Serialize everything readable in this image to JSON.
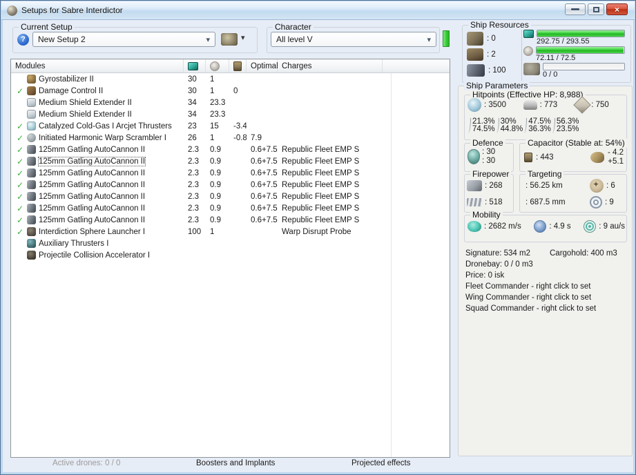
{
  "window": {
    "title": "Setups for Sabre Interdictor",
    "controls": {
      "minimize": "minimize",
      "maximize": "maximize",
      "close": "close"
    }
  },
  "toolbar": {
    "current_setup_label": "Current Setup",
    "setup_value": "New Setup 2",
    "character_label": "Character",
    "character_value": "All level V"
  },
  "modules_table": {
    "headers": {
      "modules": "Modules",
      "cpu_icon": "cpu-icon",
      "powergrid_icon": "powergrid-icon",
      "capacitor_icon": "capacitor-icon",
      "optimal": "Optimal",
      "charges": "Charges"
    },
    "rows": [
      {
        "checked": false,
        "icon": "gyrostabilizer",
        "name": "Gyrostabilizer II",
        "cpu": "30",
        "pg": "1",
        "cap": "",
        "optimal": "",
        "charges": "",
        "focused": false
      },
      {
        "checked": true,
        "icon": "damage-control",
        "name": "Damage Control II",
        "cpu": "30",
        "pg": "1",
        "cap": "0",
        "optimal": "",
        "charges": "",
        "focused": false
      },
      {
        "checked": false,
        "icon": "shield-extender",
        "name": "Medium Shield Extender II",
        "cpu": "34",
        "pg": "23.3",
        "cap": "",
        "optimal": "",
        "charges": "",
        "focused": false
      },
      {
        "checked": false,
        "icon": "shield-extender",
        "name": "Medium Shield Extender II",
        "cpu": "34",
        "pg": "23.3",
        "cap": "",
        "optimal": "",
        "charges": "",
        "focused": false
      },
      {
        "checked": true,
        "icon": "afterburner",
        "name": "Catalyzed Cold-Gas I Arcjet Thrusters",
        "cpu": "23",
        "pg": "15",
        "cap": "-3.4",
        "optimal": "",
        "charges": "",
        "focused": false
      },
      {
        "checked": true,
        "icon": "warp-scrambler",
        "name": "Initiated Harmonic Warp Scrambler I",
        "cpu": "26",
        "pg": "1",
        "cap": "-0.8",
        "optimal": "7.9",
        "charges": "",
        "focused": false
      },
      {
        "checked": true,
        "icon": "autocannon",
        "name": "125mm Gatling AutoCannon II",
        "cpu": "2.3",
        "pg": "0.9",
        "cap": "",
        "optimal": "0.6+7.5",
        "charges": "Republic Fleet EMP S",
        "focused": false
      },
      {
        "checked": true,
        "icon": "autocannon",
        "name": "125mm Gatling AutoCannon II",
        "cpu": "2.3",
        "pg": "0.9",
        "cap": "",
        "optimal": "0.6+7.5",
        "charges": "Republic Fleet EMP S",
        "focused": true
      },
      {
        "checked": true,
        "icon": "autocannon",
        "name": "125mm Gatling AutoCannon II",
        "cpu": "2.3",
        "pg": "0.9",
        "cap": "",
        "optimal": "0.6+7.5",
        "charges": "Republic Fleet EMP S",
        "focused": false
      },
      {
        "checked": true,
        "icon": "autocannon",
        "name": "125mm Gatling AutoCannon II",
        "cpu": "2.3",
        "pg": "0.9",
        "cap": "",
        "optimal": "0.6+7.5",
        "charges": "Republic Fleet EMP S",
        "focused": false
      },
      {
        "checked": true,
        "icon": "autocannon",
        "name": "125mm Gatling AutoCannon II",
        "cpu": "2.3",
        "pg": "0.9",
        "cap": "",
        "optimal": "0.6+7.5",
        "charges": "Republic Fleet EMP S",
        "focused": false
      },
      {
        "checked": true,
        "icon": "autocannon",
        "name": "125mm Gatling AutoCannon II",
        "cpu": "2.3",
        "pg": "0.9",
        "cap": "",
        "optimal": "0.6+7.5",
        "charges": "Republic Fleet EMP S",
        "focused": false
      },
      {
        "checked": true,
        "icon": "autocannon",
        "name": "125mm Gatling AutoCannon II",
        "cpu": "2.3",
        "pg": "0.9",
        "cap": "",
        "optimal": "0.6+7.5",
        "charges": "Republic Fleet EMP S",
        "focused": false
      },
      {
        "checked": true,
        "icon": "interdiction-launcher",
        "name": "Interdiction Sphere Launcher I",
        "cpu": "100",
        "pg": "1",
        "cap": "",
        "optimal": "",
        "charges": "Warp Disrupt Probe",
        "focused": false
      },
      {
        "checked": false,
        "icon": "aux-thrusters",
        "name": "Auxiliary Thrusters I",
        "cpu": "",
        "pg": "",
        "cap": "",
        "optimal": "",
        "charges": "",
        "focused": false
      },
      {
        "checked": false,
        "icon": "collision-accelerator",
        "name": "Projectile Collision Accelerator I",
        "cpu": "",
        "pg": "",
        "cap": "",
        "optimal": "",
        "charges": "",
        "focused": false
      }
    ]
  },
  "ship_resources": {
    "label": "Ship Resources",
    "slots": [
      {
        "icon": "turret-hardpoint-icon",
        "value": ": 0"
      },
      {
        "icon": "launcher-hardpoint-icon",
        "value": ": 2"
      },
      {
        "icon": "calibration-icon",
        "value": ": 100"
      }
    ],
    "bars": [
      {
        "icon": "cpu-icon",
        "text": "292.75 / 293.55",
        "fill_pct": 99.7
      },
      {
        "icon": "powergrid-icon",
        "text": "72.11 / 72.5",
        "fill_pct": 99.5
      },
      {
        "icon": "dronebay-icon",
        "text": "0 / 0",
        "fill_pct": 0
      }
    ]
  },
  "ship_parameters": {
    "label": "Ship Parameters",
    "hitpoints": {
      "label": "Hitpoints (Effective HP: 8,988)",
      "hp": [
        {
          "icon": "shield-icon",
          "value": ": 3500"
        },
        {
          "icon": "armor-icon",
          "value": ": 773"
        },
        {
          "icon": "hull-icon",
          "value": ": 750"
        }
      ],
      "resists": [
        {
          "icon": "em-resist-icon",
          "shield": "21.3%",
          "armor": "74.5%"
        },
        {
          "icon": "thermal-resist-icon",
          "shield": "30%",
          "armor": "44.8%"
        },
        {
          "icon": "kinetic-resist-icon",
          "shield": "47.5%",
          "armor": "36.3%"
        },
        {
          "icon": "explosive-resist-icon",
          "shield": "56.3%",
          "armor": "23.5%"
        }
      ]
    },
    "defence": {
      "label": "Defence",
      "icon": "defence-icon",
      "top": ": 30",
      "bottom": ": 30"
    },
    "capacitor": {
      "label": "Capacitor (Stable at: 54%)",
      "icon": "capacitor-icon",
      "value": ": 443",
      "delta_icon": "cap-delta-icon",
      "delta_top": "- 4.2",
      "delta_bottom": "+5.1"
    },
    "firepower": {
      "label": "Firepower",
      "items": [
        {
          "icon": "turret-dps-icon",
          "value": ": 268"
        },
        {
          "icon": "volley-icon",
          "value": ": 518"
        }
      ]
    },
    "targeting": {
      "label": "Targeting",
      "items": [
        {
          "icon": "targeting-range-icon",
          "value": ": 56.25 km"
        },
        {
          "icon": "max-targets-icon",
          "value": ": 6"
        },
        {
          "icon": "scan-resolution-icon",
          "value": ": 687.5 mm"
        },
        {
          "icon": "sensor-strength-icon",
          "value": ": 9"
        }
      ]
    },
    "mobility": {
      "label": "Mobility",
      "items": [
        {
          "icon": "speed-icon",
          "value": ": 2682 m/s"
        },
        {
          "icon": "align-time-icon",
          "value": ": 4.9 s"
        },
        {
          "icon": "warp-speed-icon",
          "value": ": 9 au/s"
        }
      ]
    }
  },
  "info": {
    "row1_left": "Signature: 534 m2",
    "row1_right": "Cargohold: 400 m3",
    "lines": [
      "Dronebay: 0 / 0 m3",
      "Price: 0 isk",
      "Fleet Commander - right click to set",
      "Wing Commander - right click to set",
      "Squad Commander - right click to set"
    ]
  },
  "bottom": {
    "active_drones": "Active drones: 0 / 0",
    "boosters": "Boosters and Implants",
    "projected": "Projected effects"
  },
  "colors": {
    "accent_green": "#35cc35",
    "title_gradient_top": "#f4f9fe",
    "title_gradient_bottom": "#c2dbf0",
    "close_button_red": "#c03118",
    "check_green": "#3fae3f",
    "panel_gray": "#f1f1ee",
    "window_bg": "#e7edf6"
  }
}
